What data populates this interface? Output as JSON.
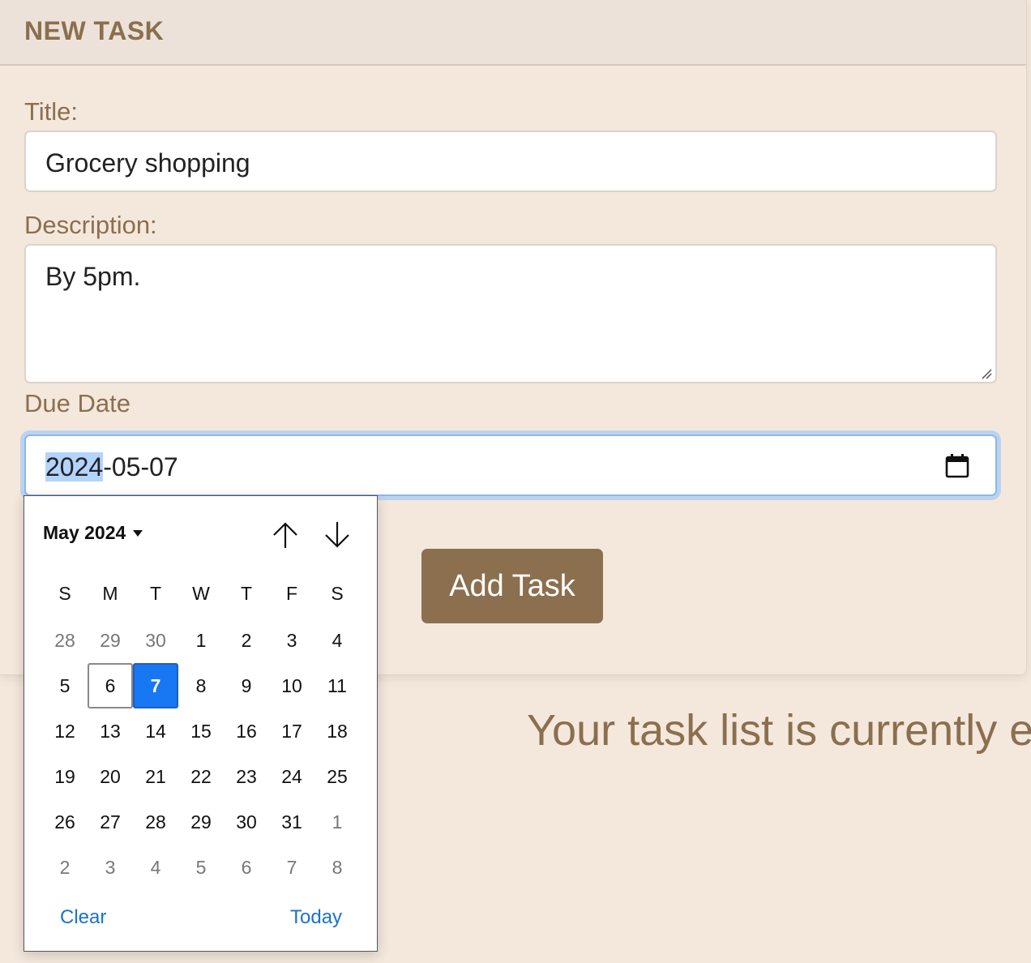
{
  "form": {
    "header": "NEW TASK",
    "title_label": "Title:",
    "title_value": "Grocery shopping",
    "description_label": "Description:",
    "description_value": "By 5pm.",
    "due_date_label": "Due Date",
    "due_date": {
      "year": "2024",
      "rest": "-05-07"
    },
    "submit_label": "Add Task"
  },
  "empty_state": "Your task list is currently e",
  "date_picker": {
    "month_label": "May 2024",
    "weekdays": [
      "S",
      "M",
      "T",
      "W",
      "T",
      "F",
      "S"
    ],
    "weeks": [
      [
        {
          "d": "28",
          "out": true
        },
        {
          "d": "29",
          "out": true
        },
        {
          "d": "30",
          "out": true
        },
        {
          "d": "1"
        },
        {
          "d": "2"
        },
        {
          "d": "3"
        },
        {
          "d": "4"
        }
      ],
      [
        {
          "d": "5"
        },
        {
          "d": "6",
          "today": true
        },
        {
          "d": "7",
          "selected": true
        },
        {
          "d": "8"
        },
        {
          "d": "9"
        },
        {
          "d": "10"
        },
        {
          "d": "11"
        }
      ],
      [
        {
          "d": "12"
        },
        {
          "d": "13"
        },
        {
          "d": "14"
        },
        {
          "d": "15"
        },
        {
          "d": "16"
        },
        {
          "d": "17"
        },
        {
          "d": "18"
        }
      ],
      [
        {
          "d": "19"
        },
        {
          "d": "20"
        },
        {
          "d": "21"
        },
        {
          "d": "22"
        },
        {
          "d": "23"
        },
        {
          "d": "24"
        },
        {
          "d": "25"
        }
      ],
      [
        {
          "d": "26"
        },
        {
          "d": "27"
        },
        {
          "d": "28"
        },
        {
          "d": "29"
        },
        {
          "d": "30"
        },
        {
          "d": "31"
        },
        {
          "d": "1",
          "out": true
        }
      ],
      [
        {
          "d": "2",
          "out": true
        },
        {
          "d": "3",
          "out": true
        },
        {
          "d": "4",
          "out": true
        },
        {
          "d": "5",
          "out": true
        },
        {
          "d": "6",
          "out": true
        },
        {
          "d": "7",
          "out": true
        },
        {
          "d": "8",
          "out": true
        }
      ]
    ],
    "clear_label": "Clear",
    "today_label": "Today"
  },
  "colors": {
    "brand_brown": "#8b6f4e",
    "background": "#f4e8dd",
    "selected_blue": "#1877f2",
    "link_blue": "#1a73c8"
  },
  "icons": [
    "calendar-icon",
    "chevron-down-icon",
    "arrow-up-icon",
    "arrow-down-icon",
    "resize-grip-icon"
  ]
}
